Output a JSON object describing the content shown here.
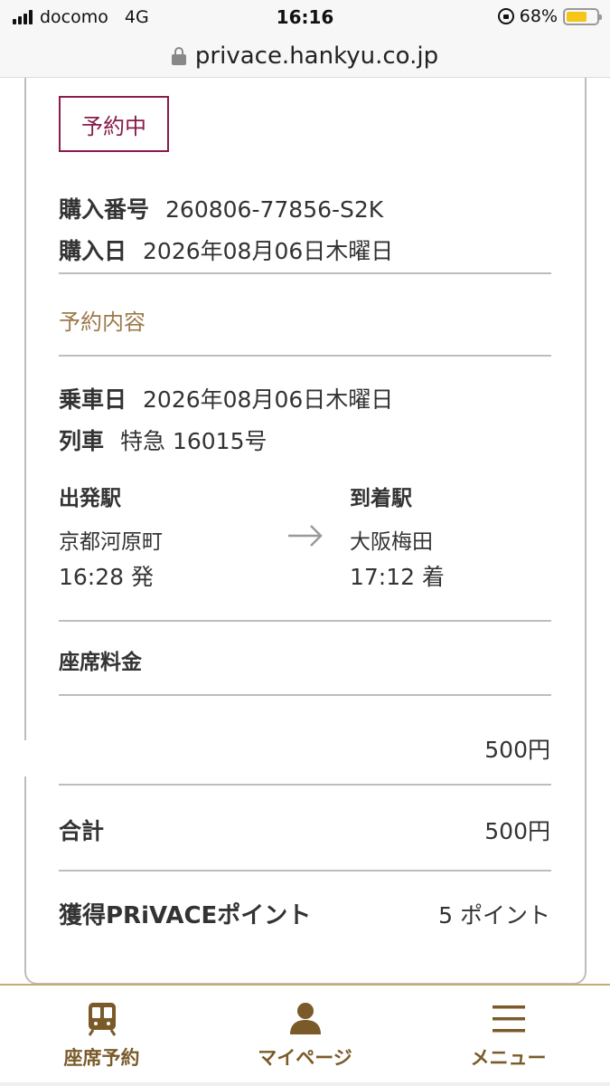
{
  "status_bar": {
    "carrier": "docomo",
    "network": "4G",
    "time": "16:16",
    "battery_percent": "68%",
    "battery_level": 0.68
  },
  "browser": {
    "url": "privace.hankyu.co.jp"
  },
  "reservation": {
    "status_badge": "予約中",
    "purchase_number_label": "購入番号",
    "purchase_number": "260806-77856-S2K",
    "purchase_date_label": "購入日",
    "purchase_date": "2026年08月06日木曜日",
    "details_title": "予約内容",
    "ride_date_label": "乗車日",
    "ride_date": "2026年08月06日木曜日",
    "train_label": "列車",
    "train": "特急 16015号",
    "departure": {
      "label": "出発駅",
      "station": "京都河原町",
      "time": "16:28  発"
    },
    "arrival": {
      "label": "到着駅",
      "station": "大阪梅田",
      "time": "17:12  着"
    },
    "seat_fee_label": "座席料金",
    "seat_fee": "500円",
    "total_label": "合計",
    "total": "500円",
    "points_label": "獲得PRiVACEポイント",
    "points": "5 ポイント"
  },
  "bottom_nav": {
    "items": [
      {
        "label": "座席予約",
        "icon": "train-icon"
      },
      {
        "label": "マイページ",
        "icon": "person-icon"
      },
      {
        "label": "メニュー",
        "icon": "hamburger-menu-icon"
      }
    ]
  },
  "colors": {
    "badge": "#8a1b4b",
    "section_title": "#9c7a4a",
    "nav_accent": "#7b5a2a",
    "nav_border": "#c9a877",
    "battery": "#f5c518"
  }
}
